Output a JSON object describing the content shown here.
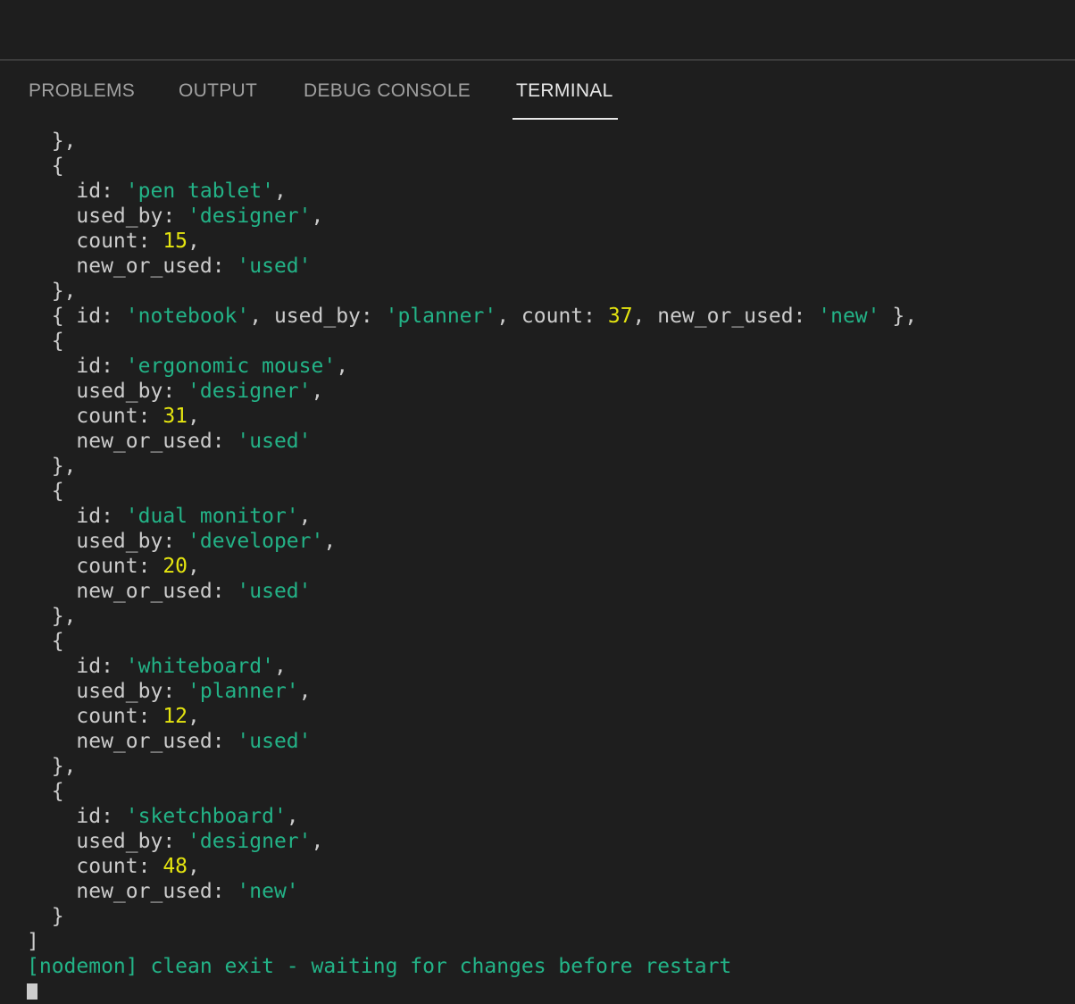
{
  "panel": {
    "tabs": [
      {
        "label": "PROBLEMS",
        "active": false
      },
      {
        "label": "OUTPUT",
        "active": false
      },
      {
        "label": "DEBUG CONSOLE",
        "active": false
      },
      {
        "label": "TERMINAL",
        "active": true
      }
    ]
  },
  "terminal": {
    "colors": {
      "background": "#1e1e1e",
      "text": "#cccccc",
      "string": "#23b387",
      "number": "#e5e510"
    },
    "lines": [
      [
        {
          "t": "  },",
          "c": "p"
        }
      ],
      [
        {
          "t": "  {",
          "c": "p"
        }
      ],
      [
        {
          "t": "    id: ",
          "c": "p"
        },
        {
          "t": "'pen tablet'",
          "c": "s"
        },
        {
          "t": ",",
          "c": "p"
        }
      ],
      [
        {
          "t": "    used_by: ",
          "c": "p"
        },
        {
          "t": "'designer'",
          "c": "s"
        },
        {
          "t": ",",
          "c": "p"
        }
      ],
      [
        {
          "t": "    count: ",
          "c": "p"
        },
        {
          "t": "15",
          "c": "n"
        },
        {
          "t": ",",
          "c": "p"
        }
      ],
      [
        {
          "t": "    new_or_used: ",
          "c": "p"
        },
        {
          "t": "'used'",
          "c": "s"
        }
      ],
      [
        {
          "t": "  },",
          "c": "p"
        }
      ],
      [
        {
          "t": "  { id: ",
          "c": "p"
        },
        {
          "t": "'notebook'",
          "c": "s"
        },
        {
          "t": ", used_by: ",
          "c": "p"
        },
        {
          "t": "'planner'",
          "c": "s"
        },
        {
          "t": ", count: ",
          "c": "p"
        },
        {
          "t": "37",
          "c": "n"
        },
        {
          "t": ", new_or_used: ",
          "c": "p"
        },
        {
          "t": "'new'",
          "c": "s"
        },
        {
          "t": " },",
          "c": "p"
        }
      ],
      [
        {
          "t": "  {",
          "c": "p"
        }
      ],
      [
        {
          "t": "    id: ",
          "c": "p"
        },
        {
          "t": "'ergonomic mouse'",
          "c": "s"
        },
        {
          "t": ",",
          "c": "p"
        }
      ],
      [
        {
          "t": "    used_by: ",
          "c": "p"
        },
        {
          "t": "'designer'",
          "c": "s"
        },
        {
          "t": ",",
          "c": "p"
        }
      ],
      [
        {
          "t": "    count: ",
          "c": "p"
        },
        {
          "t": "31",
          "c": "n"
        },
        {
          "t": ",",
          "c": "p"
        }
      ],
      [
        {
          "t": "    new_or_used: ",
          "c": "p"
        },
        {
          "t": "'used'",
          "c": "s"
        }
      ],
      [
        {
          "t": "  },",
          "c": "p"
        }
      ],
      [
        {
          "t": "  {",
          "c": "p"
        }
      ],
      [
        {
          "t": "    id: ",
          "c": "p"
        },
        {
          "t": "'dual monitor'",
          "c": "s"
        },
        {
          "t": ",",
          "c": "p"
        }
      ],
      [
        {
          "t": "    used_by: ",
          "c": "p"
        },
        {
          "t": "'developer'",
          "c": "s"
        },
        {
          "t": ",",
          "c": "p"
        }
      ],
      [
        {
          "t": "    count: ",
          "c": "p"
        },
        {
          "t": "20",
          "c": "n"
        },
        {
          "t": ",",
          "c": "p"
        }
      ],
      [
        {
          "t": "    new_or_used: ",
          "c": "p"
        },
        {
          "t": "'used'",
          "c": "s"
        }
      ],
      [
        {
          "t": "  },",
          "c": "p"
        }
      ],
      [
        {
          "t": "  {",
          "c": "p"
        }
      ],
      [
        {
          "t": "    id: ",
          "c": "p"
        },
        {
          "t": "'whiteboard'",
          "c": "s"
        },
        {
          "t": ",",
          "c": "p"
        }
      ],
      [
        {
          "t": "    used_by: ",
          "c": "p"
        },
        {
          "t": "'planner'",
          "c": "s"
        },
        {
          "t": ",",
          "c": "p"
        }
      ],
      [
        {
          "t": "    count: ",
          "c": "p"
        },
        {
          "t": "12",
          "c": "n"
        },
        {
          "t": ",",
          "c": "p"
        }
      ],
      [
        {
          "t": "    new_or_used: ",
          "c": "p"
        },
        {
          "t": "'used'",
          "c": "s"
        }
      ],
      [
        {
          "t": "  },",
          "c": "p"
        }
      ],
      [
        {
          "t": "  {",
          "c": "p"
        }
      ],
      [
        {
          "t": "    id: ",
          "c": "p"
        },
        {
          "t": "'sketchboard'",
          "c": "s"
        },
        {
          "t": ",",
          "c": "p"
        }
      ],
      [
        {
          "t": "    used_by: ",
          "c": "p"
        },
        {
          "t": "'designer'",
          "c": "s"
        },
        {
          "t": ",",
          "c": "p"
        }
      ],
      [
        {
          "t": "    count: ",
          "c": "p"
        },
        {
          "t": "48",
          "c": "n"
        },
        {
          "t": ",",
          "c": "p"
        }
      ],
      [
        {
          "t": "    new_or_used: ",
          "c": "p"
        },
        {
          "t": "'new'",
          "c": "s"
        }
      ],
      [
        {
          "t": "  }",
          "c": "p"
        }
      ],
      [
        {
          "t": "]",
          "c": "p"
        }
      ]
    ],
    "status_line": "[nodemon] clean exit - waiting for changes before restart"
  }
}
